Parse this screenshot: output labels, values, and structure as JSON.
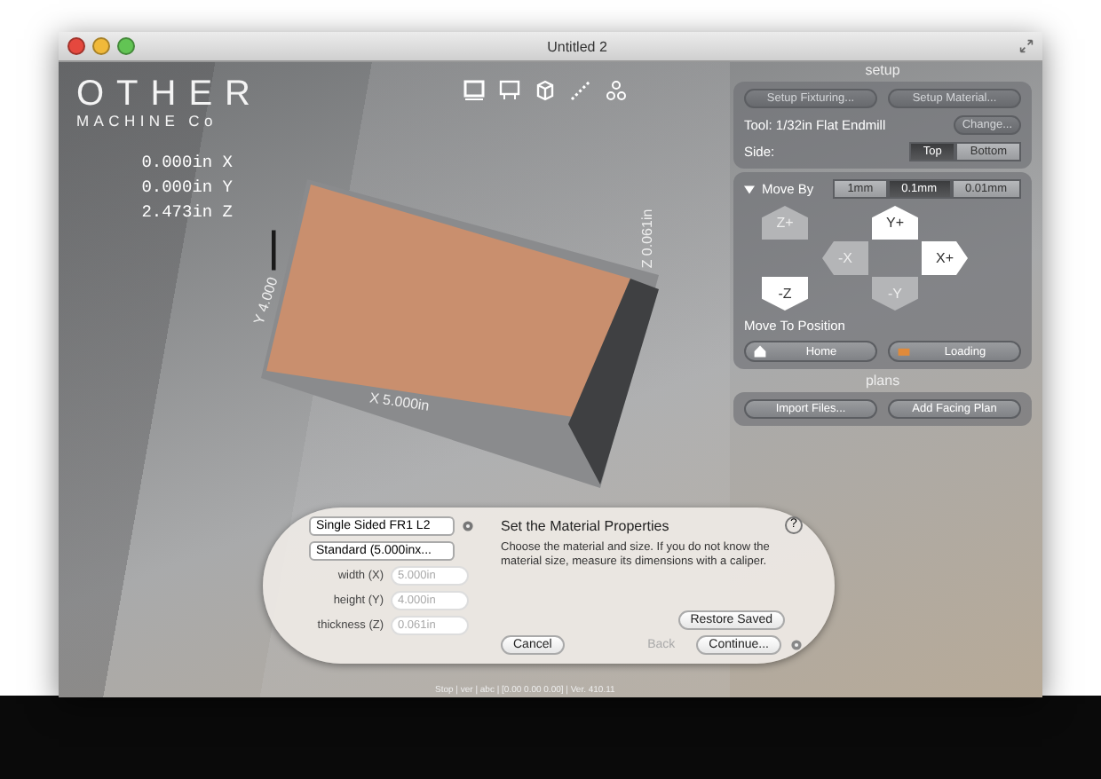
{
  "window": {
    "title": "Untitled 2"
  },
  "logo": {
    "line_1": "OTHER",
    "line_2": "MACHINE Co"
  },
  "position": [
    {
      "value": "0.000in",
      "axis": "X"
    },
    {
      "value": "0.000in",
      "axis": "Y"
    },
    {
      "value": "2.473in",
      "axis": "Z"
    }
  ],
  "board_labels": {
    "x": "X 5.000in",
    "y": "Y 4.000",
    "z": "Z 0.061in"
  },
  "setup": {
    "title": "setup",
    "buttons": [
      {
        "label": "Setup Fixturing...",
        "disabled": true
      },
      {
        "label": "Setup Material...",
        "disabled": true
      }
    ],
    "tool": "Tool: 1/32in Flat Endmill",
    "change_button": {
      "label": "Change...",
      "disabled": true
    },
    "side_label": "Side:",
    "sides": [
      {
        "label": "Top",
        "selected": true
      },
      {
        "label": "Bottom",
        "selected": false
      }
    ]
  },
  "move_by": {
    "label": "Move By",
    "expanded": true,
    "steps": [
      {
        "label": "1mm",
        "selected": false
      },
      {
        "label": "0.1mm",
        "selected": true
      },
      {
        "label": "0.01mm",
        "selected": false
      }
    ],
    "jog": [
      {
        "label": "Z+",
        "kind": "up",
        "disabled": true
      },
      {
        "label": "-Z",
        "kind": "down",
        "disabled": false
      },
      {
        "label": "Y+",
        "kind": "up",
        "disabled": false
      },
      {
        "label": "-X",
        "kind": "left",
        "disabled": true
      },
      {
        "label": "X+",
        "kind": "right",
        "disabled": false
      },
      {
        "label": "-Y",
        "kind": "down",
        "disabled": true
      }
    ]
  },
  "move_to": {
    "label": "Move To Position",
    "buttons": [
      "Home",
      "Loading"
    ]
  },
  "plans": {
    "title": "plans",
    "buttons": [
      "Import Files...",
      "Add Facing Plan"
    ]
  },
  "dialog": {
    "material": "Single Sided FR1 L2",
    "size": "Standard (5.000inx...",
    "fields": [
      {
        "label": "width (X)",
        "value": "5.000in"
      },
      {
        "label": "height (Y)",
        "value": "4.000in"
      },
      {
        "label": "thickness (Z)",
        "value": "0.061in"
      }
    ],
    "title": "Set the Material Properties",
    "help": "?",
    "description": "Choose the material and size. If you do not know the material size, measure its dimensions with a caliper.",
    "restore": "Restore Saved",
    "cancel": "Cancel",
    "back": {
      "label": "Back",
      "disabled": true
    },
    "continue": "Continue..."
  },
  "status_bar": "Stop | ver | abc | [0.00 0.00 0.00] | Ver. 410.11"
}
